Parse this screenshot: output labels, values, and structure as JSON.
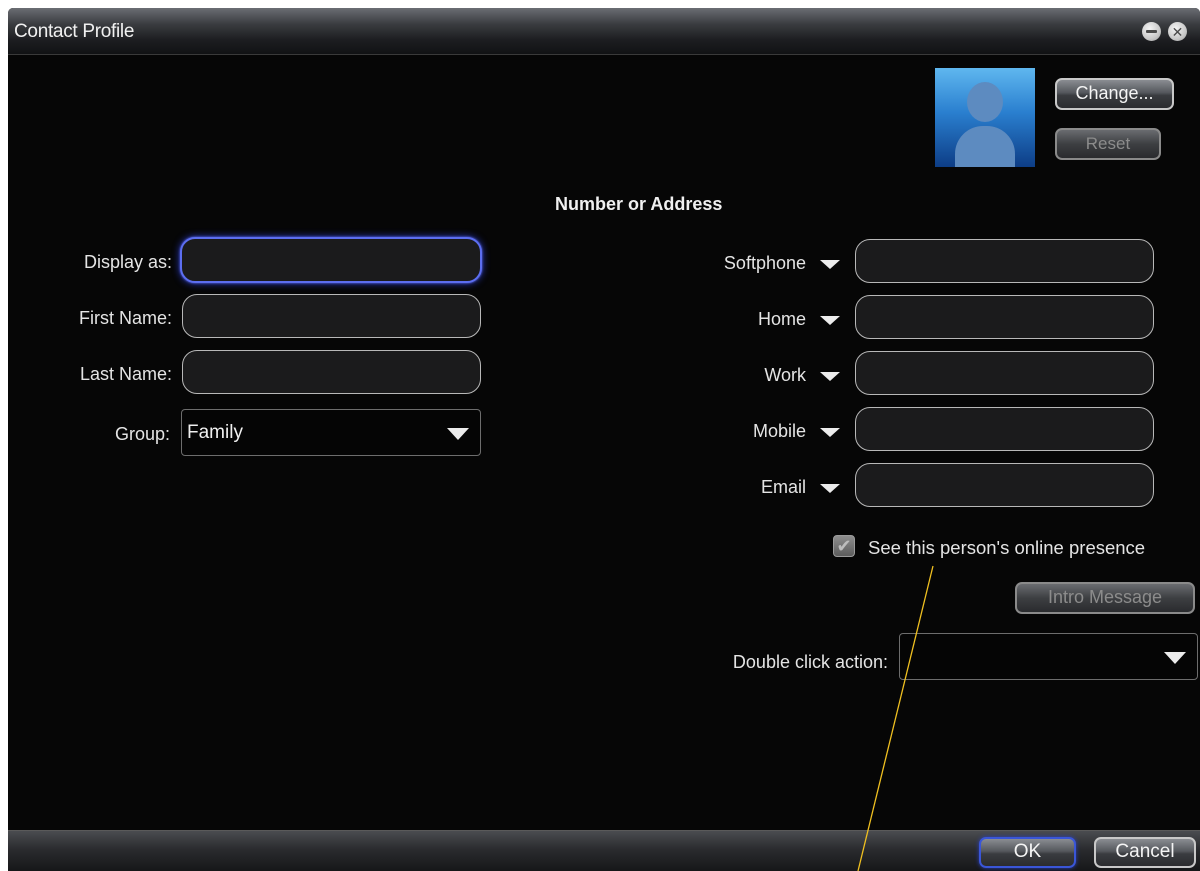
{
  "window": {
    "title": "Contact Profile"
  },
  "photo": {
    "change_label": "Change...",
    "reset_label": "Reset"
  },
  "left_form": {
    "display_as_label": "Display as:",
    "display_as_value": "",
    "first_name_label": "First Name:",
    "first_name_value": "",
    "last_name_label": "Last Name:",
    "last_name_value": "",
    "group_label": "Group:",
    "group_value": "Family"
  },
  "addresses": {
    "heading": "Number or Address",
    "items": [
      {
        "label": "Softphone",
        "value": ""
      },
      {
        "label": "Home",
        "value": ""
      },
      {
        "label": "Work",
        "value": ""
      },
      {
        "label": "Mobile",
        "value": ""
      },
      {
        "label": "Email",
        "value": ""
      }
    ]
  },
  "presence": {
    "label": "See this person's online presence",
    "checked": true,
    "disabled": true
  },
  "intro_message_label": "Intro Message",
  "double_click": {
    "label": "Double click action:",
    "value": ""
  },
  "footer": {
    "ok_label": "OK",
    "cancel_label": "Cancel"
  },
  "colors": {
    "focus_glow": "#3a4cf0",
    "annotation_line": "#f0c020"
  }
}
